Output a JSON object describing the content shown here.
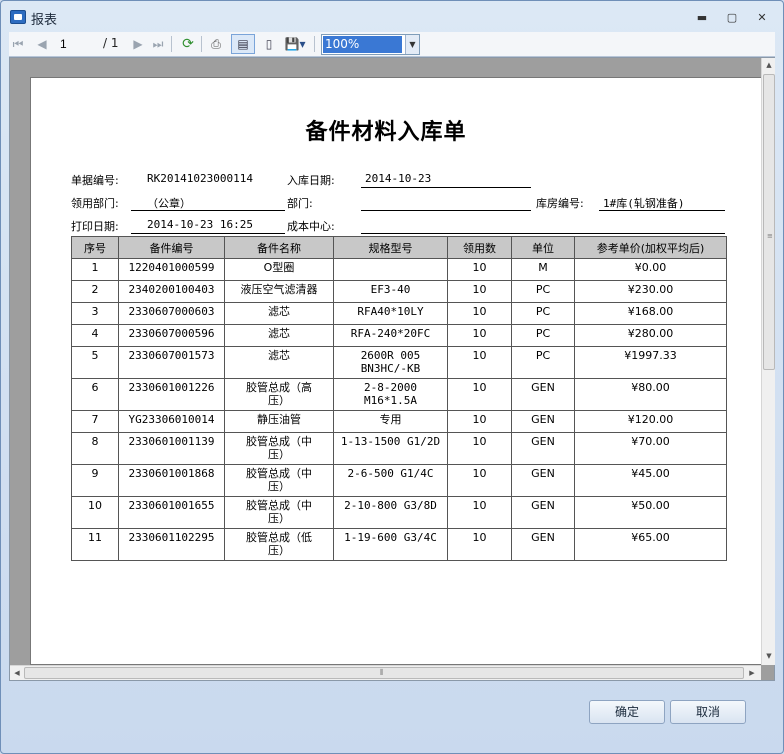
{
  "window": {
    "title": "报表",
    "minimize": "▬",
    "maximize": "▢",
    "close": "✕"
  },
  "toolbar": {
    "first_icon": "⏮",
    "prev_icon": "◀",
    "page": "1",
    "page_total": "/ 1",
    "next_icon": "▶",
    "last_icon": "⏭",
    "refresh_icon": "⟳",
    "print_icon": "⎙",
    "layout_icon": "▤",
    "pagesetup_icon": "▯",
    "export_icon": "💾▾",
    "zoom": "100%",
    "zoom_arrow": "▼"
  },
  "report": {
    "title": "备件材料入库单",
    "fields": {
      "doc_no_label": "单据编号:",
      "doc_no": "RK20141023000114",
      "in_date_label": "入库日期:",
      "in_date": "2014-10-23",
      "dept_use_label": "领用部门:",
      "dept_use": "（公章）",
      "dept_label": "部门:",
      "dept": "",
      "warehouse_label": "库房编号:",
      "warehouse": "1#库(轧钢准备)",
      "print_date_label": "打印日期:",
      "print_date": "2014-10-23 16:25",
      "cost_center_label": "成本中心:",
      "cost_center": ""
    },
    "columns": [
      "序号",
      "备件编号",
      "备件名称",
      "规格型号",
      "领用数",
      "单位",
      "参考单价(加权平均后)"
    ],
    "rows": [
      {
        "no": "1",
        "code": "1220401000599",
        "name": "O型圈",
        "spec": "",
        "qty": "10",
        "unit": "M",
        "price": "¥0.00"
      },
      {
        "no": "2",
        "code": "2340200100403",
        "name": "液压空气滤清器",
        "spec": "EF3-40",
        "qty": "10",
        "unit": "PC",
        "price": "¥230.00"
      },
      {
        "no": "3",
        "code": "2330607000603",
        "name": "滤芯",
        "spec": "RFA40*10LY",
        "qty": "10",
        "unit": "PC",
        "price": "¥168.00"
      },
      {
        "no": "4",
        "code": "2330607000596",
        "name": "滤芯",
        "spec": "RFA-240*20FC",
        "qty": "10",
        "unit": "PC",
        "price": "¥280.00"
      },
      {
        "no": "5",
        "code": "2330607001573",
        "name": "滤芯",
        "spec": "2600R 005\nBN3HC/-KB",
        "qty": "10",
        "unit": "PC",
        "price": "¥1997.33"
      },
      {
        "no": "6",
        "code": "2330601001226",
        "name": "胶管总成（高\n压）",
        "spec": "2-8-2000\nM16*1.5A",
        "qty": "10",
        "unit": "GEN",
        "price": "¥80.00"
      },
      {
        "no": "7",
        "code": "YG23306010014",
        "name": "静压油管",
        "spec": "专用",
        "qty": "10",
        "unit": "GEN",
        "price": "¥120.00"
      },
      {
        "no": "8",
        "code": "2330601001139",
        "name": "胶管总成（中\n压）",
        "spec": "1-13-1500  G1/2D",
        "qty": "10",
        "unit": "GEN",
        "price": "¥70.00"
      },
      {
        "no": "9",
        "code": "2330601001868",
        "name": "胶管总成（中\n压）",
        "spec": "2-6-500  G1/4C",
        "qty": "10",
        "unit": "GEN",
        "price": "¥45.00"
      },
      {
        "no": "10",
        "code": "2330601001655",
        "name": "胶管总成（中\n压）",
        "spec": "2-10-800  G3/8D",
        "qty": "10",
        "unit": "GEN",
        "price": "¥50.00"
      },
      {
        "no": "11",
        "code": "2330601102295",
        "name": "胶管总成（低\n压）",
        "spec": "1-19-600  G3/4C",
        "qty": "10",
        "unit": "GEN",
        "price": "¥65.00"
      }
    ]
  },
  "scrollbars": {
    "up": "▲",
    "down": "▼",
    "left": "◀",
    "right": "▶",
    "v_grip": "≡",
    "h_grip": "⦀"
  },
  "buttons": {
    "ok": "确定",
    "cancel": "取消"
  }
}
